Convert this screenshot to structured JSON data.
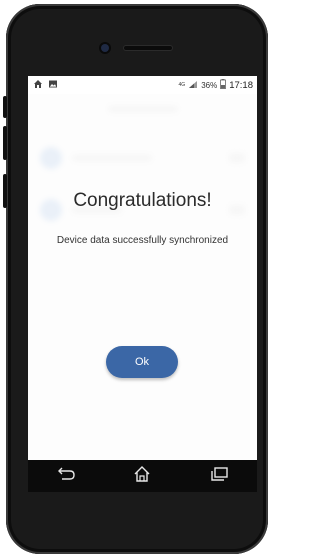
{
  "status_bar": {
    "network": "4G",
    "battery": "36%",
    "time": "17:18"
  },
  "dialog": {
    "title": "Congratulations!",
    "message": "Device data successfully synchronized",
    "ok_label": "Ok"
  },
  "colors": {
    "accent": "#3b67a6",
    "phone_body": "#1a1a1a"
  }
}
